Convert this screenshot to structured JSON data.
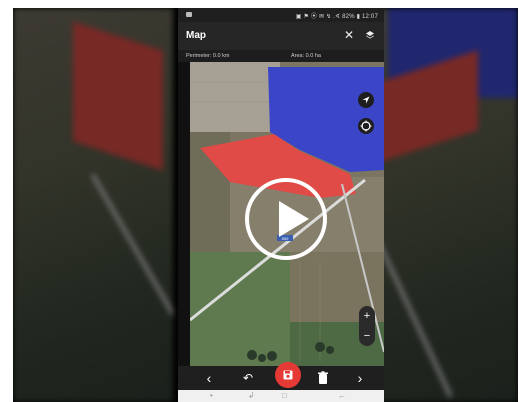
{
  "statusbar": {
    "right_text": "▣ ⚑ ⦿ ✉ ↯ .∢ 82% ▮ 12:07"
  },
  "appbar": {
    "title": "Map"
  },
  "infobar": {
    "perimeter": "Perimeter: 0.0 km",
    "area": "Area: 0.0 ha"
  },
  "map": {
    "scale_label": "500"
  },
  "icons": {
    "close": "✕",
    "zoom_in": "+",
    "zoom_out": "−",
    "prev": "‹",
    "next": "›",
    "undo": "↶",
    "nav_back": "←",
    "nav_recent": "□",
    "nav_home": "•",
    "nav_tasks": "↲"
  },
  "colors": {
    "polygon_red": "#e04a47",
    "polygon_blue": "#3b45c8",
    "save": "#e53935"
  }
}
